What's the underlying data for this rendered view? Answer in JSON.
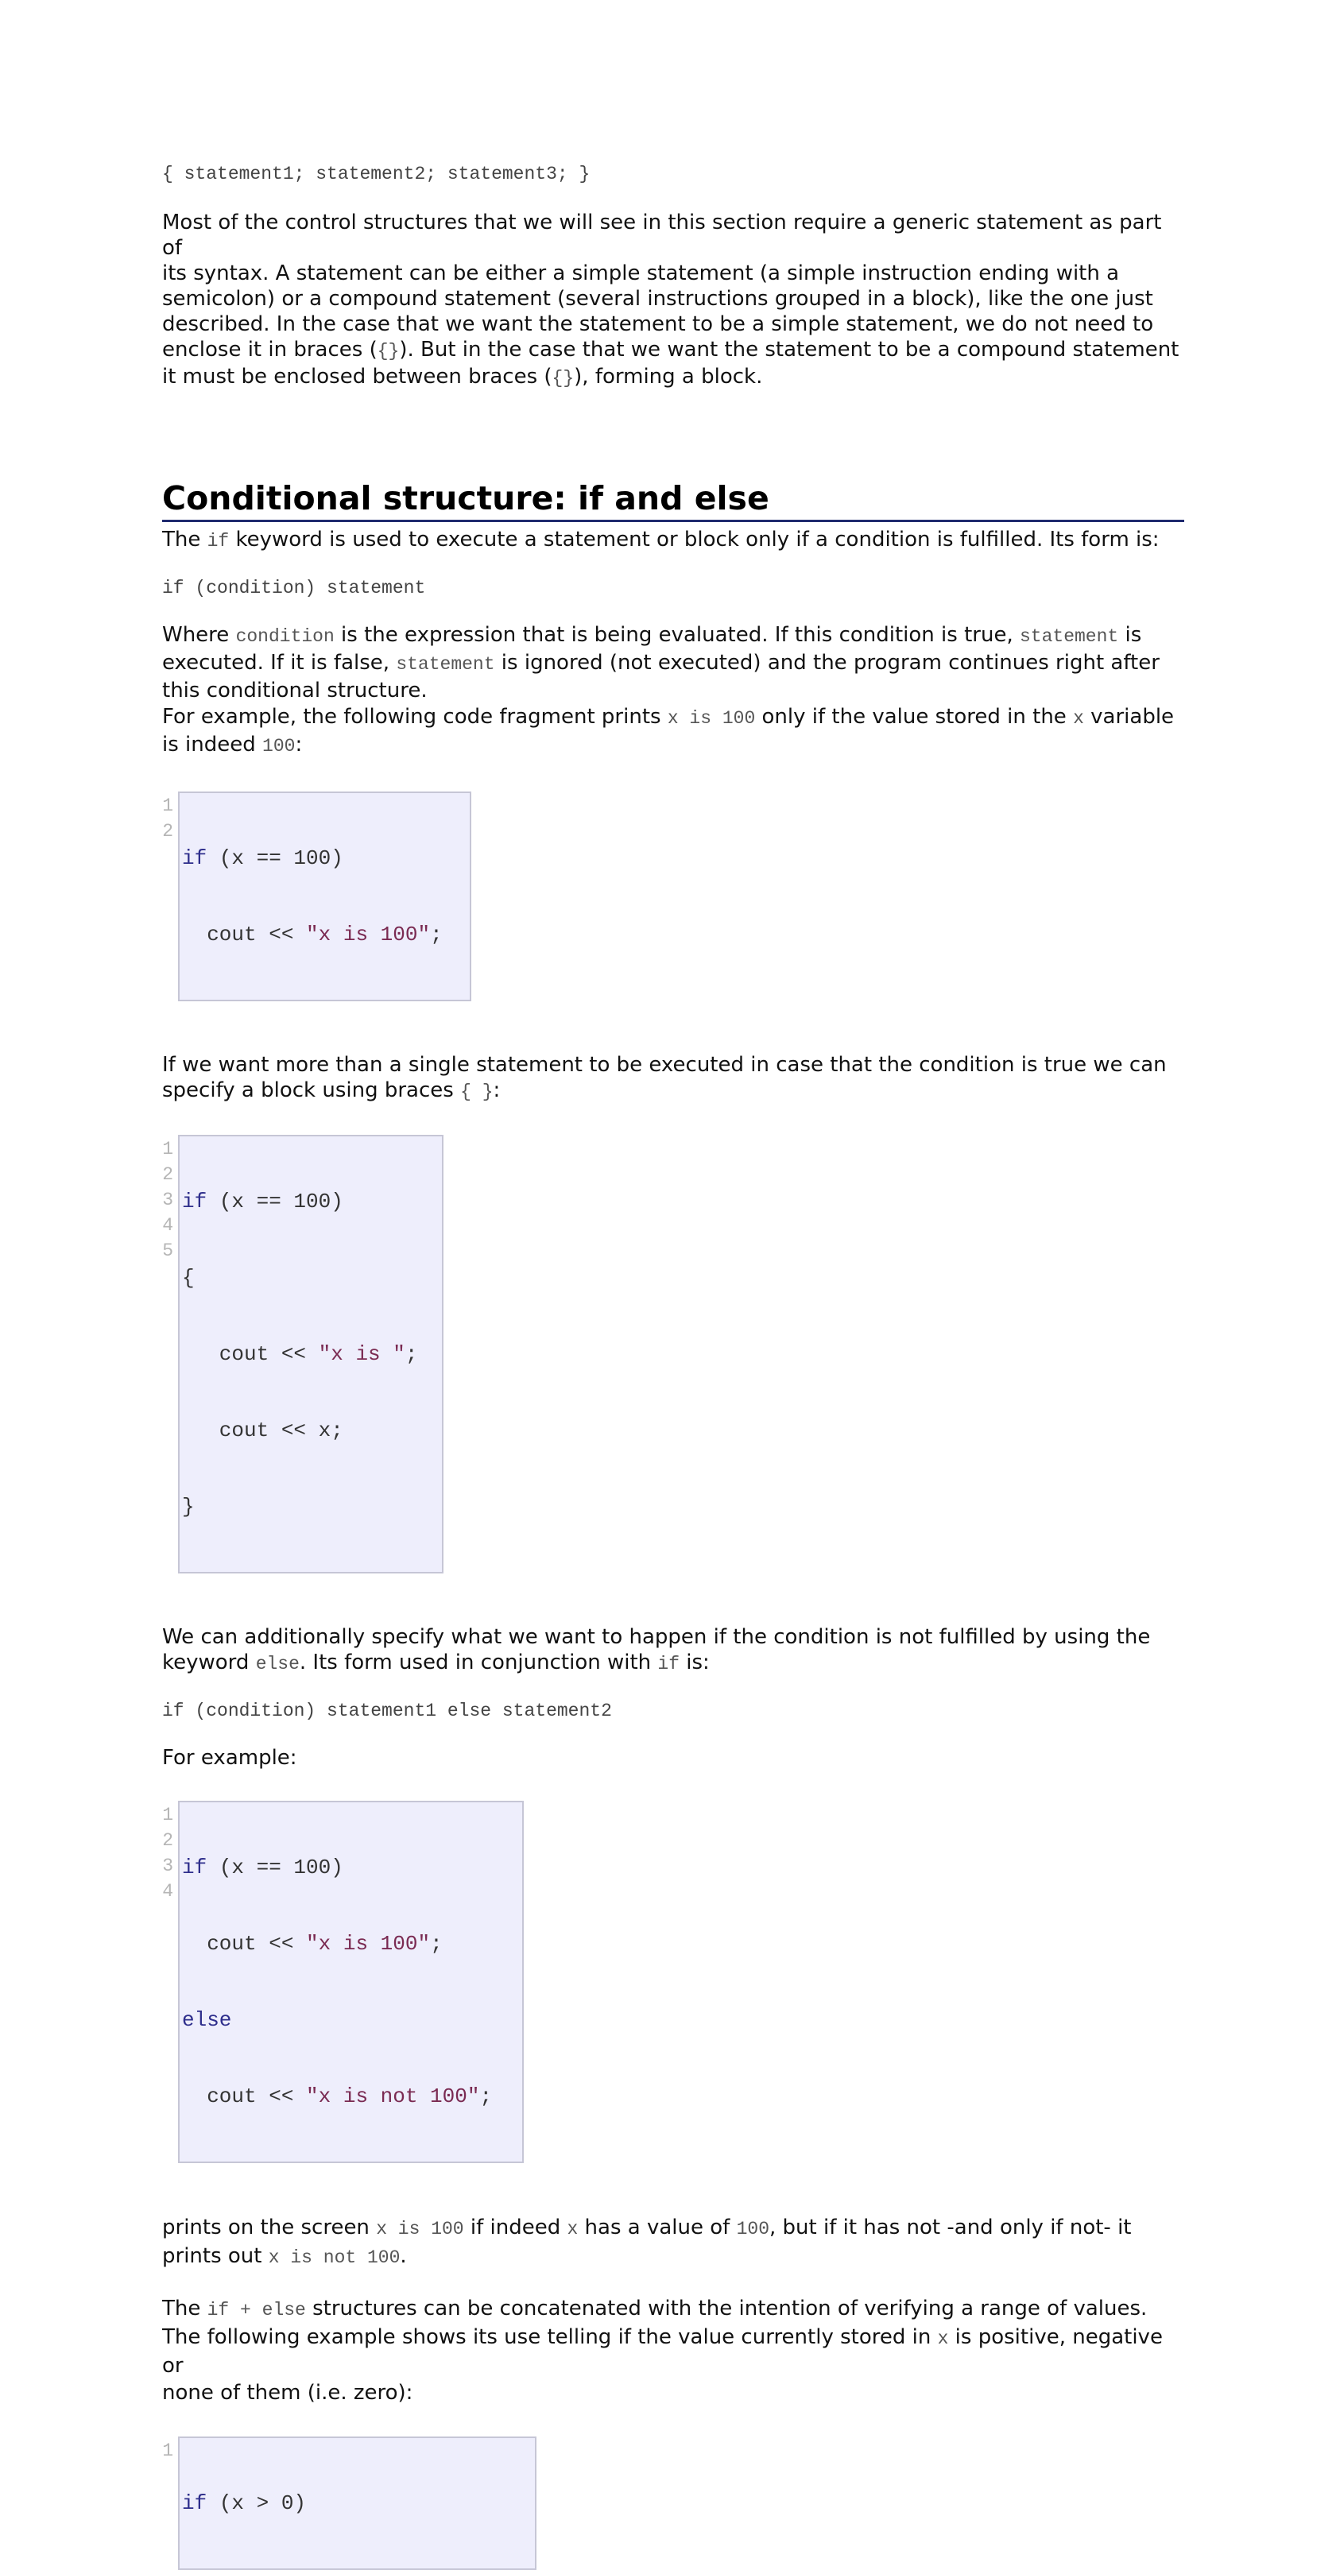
{
  "block_example": "{ statement1; statement2; statement3; }",
  "intro_paragraph": {
    "line1": "Most of the control structures that we will see in this section require a generic statement as part of",
    "line2": "its syntax. A statement can be either a simple statement (a simple instruction ending with a",
    "line3": "semicolon) or a compound statement (several instructions grouped in a block), like the one just",
    "line4": "described. In the case that we want the statement to be a simple statement, we do not need to",
    "line5a": "enclose it in braces (",
    "line5code": "{}",
    "line5b": "). But in the case that we want the statement to be a compound statement",
    "line6a": "it must be enclosed between braces (",
    "line6code": "{}",
    "line6b": "), forming a block."
  },
  "section_title": "Conditional structure: if and else",
  "if_intro": {
    "a": "The ",
    "code": "if",
    "b": " keyword is used to execute a statement or block only if a condition is fulfilled. Its form is:"
  },
  "if_form": "if (condition) statement",
  "where_paragraph": {
    "a": "Where ",
    "code1": "condition",
    "b": " is the expression that is being evaluated. If this condition is true, ",
    "code2": "statement",
    "c": " is",
    "d": "executed. If it is false, ",
    "code3": "statement",
    "e": " is ignored (not executed) and the program continues right after",
    "f": "this conditional structure.",
    "g": "For example, the following code fragment prints ",
    "code4": "x is 100",
    "h": " only if the value stored in the ",
    "code5": "x",
    "i": " variable",
    "j": "is indeed ",
    "code6": "100",
    "k": ":"
  },
  "code1": {
    "line_numbers": [
      "1",
      "2"
    ],
    "l1": {
      "kw": "if",
      "rest": " (x == 100)"
    },
    "l2": {
      "pre": "  cout << ",
      "str": "\"x is 100\"",
      "post": ";"
    }
  },
  "block_paragraph": {
    "a": "If we want more than a single statement to be executed in case that the condition is true we can",
    "b": "specify a block using braces ",
    "code": "{ }",
    "c": ":"
  },
  "code2": {
    "line_numbers": [
      "1",
      "2",
      "3",
      "4",
      "5"
    ],
    "l1": {
      "kw": "if",
      "rest": " (x == 100)"
    },
    "l2": "{",
    "l3": {
      "pre": "   cout << ",
      "str": "\"x is \"",
      "post": ";"
    },
    "l4": "   cout << x;",
    "l5": "}"
  },
  "else_paragraph": {
    "a": "We can additionally specify what we want to happen if the condition is not fulfilled by using the",
    "b": "keyword ",
    "code1": "else",
    "c": ". Its form used in conjunction with ",
    "code2": "if",
    "d": " is:"
  },
  "else_form": "if (condition) statement1 else statement2",
  "for_example": "For example:",
  "code3": {
    "line_numbers": [
      "1",
      "2",
      "3",
      "4"
    ],
    "l1": {
      "kw": "if",
      "rest": " (x == 100)"
    },
    "l2": {
      "pre": "  cout << ",
      "str": "\"x is 100\"",
      "post": ";"
    },
    "l3": {
      "kw": "else"
    },
    "l4": {
      "pre": "  cout << ",
      "str": "\"x is not 100\"",
      "post": ";"
    }
  },
  "prints_paragraph": {
    "a": "prints on the screen ",
    "code1": "x is 100",
    "b": " if indeed ",
    "code2": "x",
    "c": " has a value of ",
    "code3": "100",
    "d": ", but if it has not -and only if not- it",
    "e": "prints out ",
    "code4": "x is not 100",
    "f": "."
  },
  "concat_paragraph": {
    "a": "The ",
    "code1": "if + else",
    "b": " structures can be concatenated with the intention of verifying a range of values.",
    "c": "The following example shows its use telling if the value currently stored in ",
    "code2": "x",
    "d": " is positive, negative or",
    "e": "none of them (i.e. zero):"
  },
  "code4": {
    "line_numbers": [
      "1"
    ],
    "l1": {
      "kw": "if",
      "rest": " (x > 0)"
    }
  }
}
